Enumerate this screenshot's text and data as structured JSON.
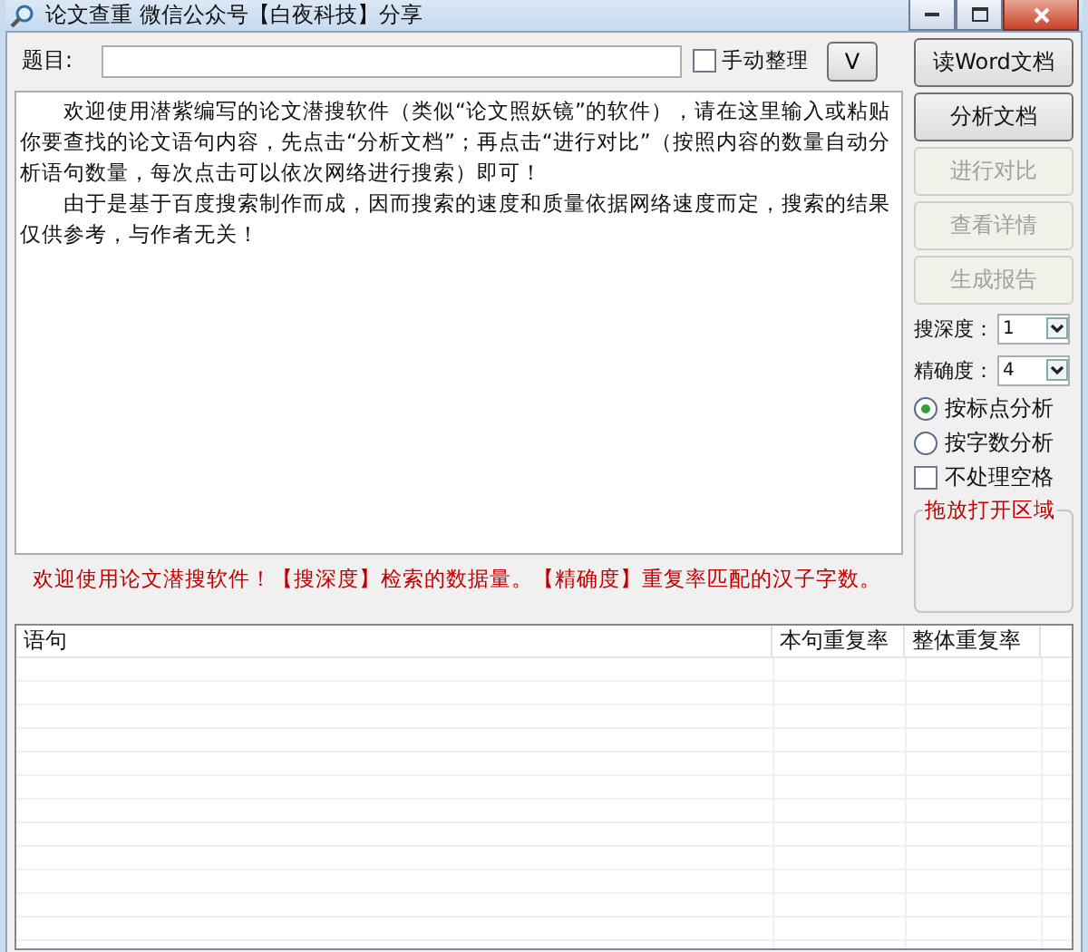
{
  "window": {
    "title": "论文查重 微信公众号【白夜科技】分享"
  },
  "topic": {
    "label": "题目:",
    "manual_sort": {
      "label": "手动整理",
      "checked": false
    },
    "toggle_button": "V"
  },
  "content": [
    "　　欢迎使用潜紫编写的论文潜搜软件（类似“论文照妖镜”的软件），请在这里输入或粘贴你要查找的论文语句内容，先点击“分析文档”；再点击“进行对比”（按照内容的数量自动分析语句数量，每次点击可以依次网络进行搜索）即可！",
    "　　由于是基于百度搜索制作而成，因而搜索的速度和质量依据网络速度而定，搜索的结果仅供参考，与作者无关！"
  ],
  "buttons": [
    {
      "label": "读Word文档",
      "disabled": false
    },
    {
      "label": "分析文档",
      "disabled": false
    },
    {
      "label": "进行对比",
      "disabled": true
    },
    {
      "label": "查看详情",
      "disabled": true
    },
    {
      "label": "生成报告",
      "disabled": true
    }
  ],
  "selects": [
    {
      "label": "搜深度：",
      "value": "1"
    },
    {
      "label": "精确度：",
      "value": "4"
    }
  ],
  "radios": [
    {
      "label": "按标点分析",
      "selected": true
    },
    {
      "label": "按字数分析",
      "selected": false
    }
  ],
  "ignore_spaces": {
    "label": "不处理空格",
    "checked": false
  },
  "drop_area": {
    "title": "拖放打开区域"
  },
  "hint": "欢迎使用论文潜搜软件！【搜深度】检索的数据量。【精确度】重复率匹配的汉子字数。",
  "table": {
    "columns": [
      "语句",
      "本句重复率",
      "整体重复率"
    ]
  }
}
